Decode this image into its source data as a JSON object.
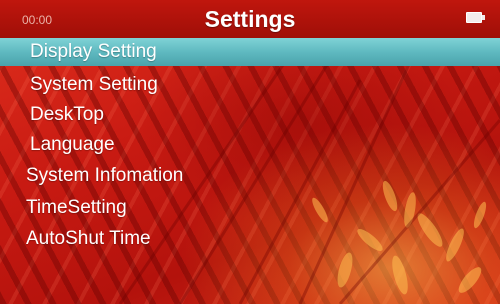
{
  "header": {
    "title": "Settings",
    "time": "00:00",
    "battery_icon": "battery-icon"
  },
  "menu": {
    "items": [
      {
        "label": "Display Setting",
        "selected": true
      },
      {
        "label": "System Setting",
        "selected": false
      },
      {
        "label": "DeskTop",
        "selected": false
      },
      {
        "label": "Language",
        "selected": false
      },
      {
        "label": "System Infomation",
        "selected": false
      },
      {
        "label": "TimeSetting",
        "selected": false
      },
      {
        "label": "AutoShut Time",
        "selected": false
      }
    ]
  },
  "colors": {
    "header": "#b3120c",
    "background": "#d12a18",
    "highlight": "#5fb9c0",
    "text": "#ffffff"
  }
}
